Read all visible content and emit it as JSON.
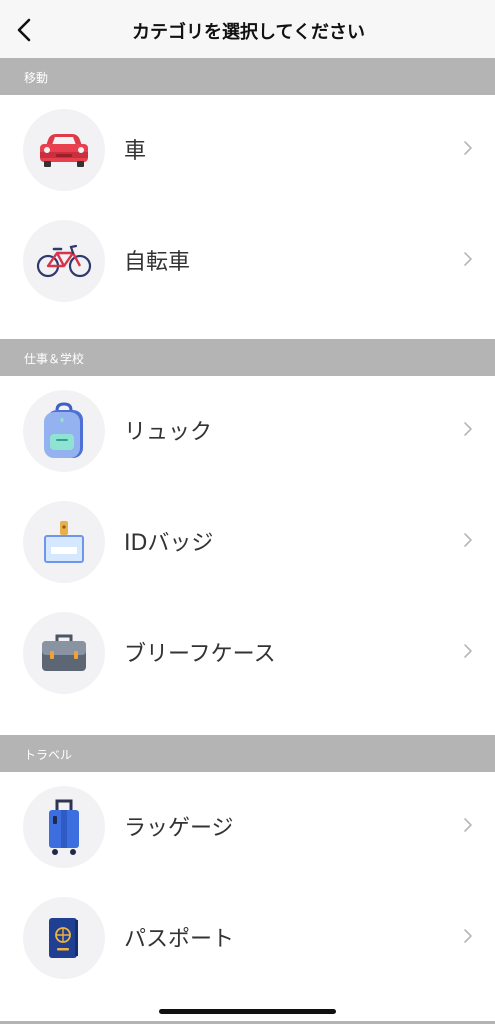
{
  "header": {
    "title": "カテゴリを選択してください"
  },
  "sections": [
    {
      "label": "移動",
      "items": [
        {
          "label": "車"
        },
        {
          "label": "自転車"
        }
      ]
    },
    {
      "label": "仕事＆学校",
      "items": [
        {
          "label": "リュック"
        },
        {
          "label": "IDバッジ"
        },
        {
          "label": "ブリーフケース"
        }
      ]
    },
    {
      "label": "トラベル",
      "items": [
        {
          "label": "ラッゲージ"
        },
        {
          "label": "パスポート"
        }
      ]
    }
  ],
  "icons": {
    "car": "car-icon",
    "bicycle": "bicycle-icon",
    "backpack": "backpack-icon",
    "id_badge": "id-badge-icon",
    "briefcase": "briefcase-icon",
    "luggage": "luggage-icon",
    "passport": "passport-icon"
  },
  "colors": {
    "section_bg": "#b4b4b4",
    "icon_circle_bg": "#f2f2f4",
    "header_bg": "#f7f7f7"
  }
}
